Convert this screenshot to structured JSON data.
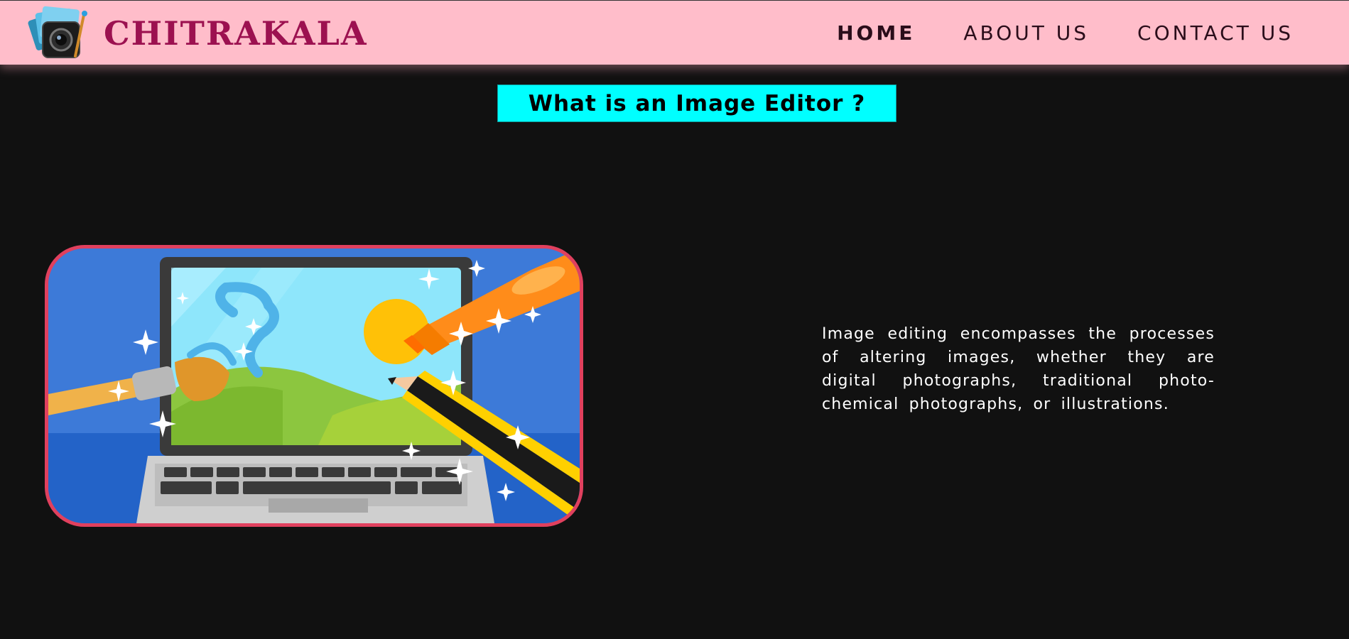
{
  "header": {
    "brand": "CHITRAKALA",
    "logo_icon": "camera-photos-icon",
    "nav": [
      {
        "label": "HOME",
        "active": true
      },
      {
        "label": "ABOUT US",
        "active": false
      },
      {
        "label": "CONTACT US",
        "active": false
      }
    ]
  },
  "main": {
    "heading": "What is an Image Editor ?",
    "illustration_icon": "laptop-image-editing-icon",
    "description": "Image editing encompasses the processes of altering images, whether they are digital photographs, traditional photo-chemical photographs, or illustrations."
  },
  "colors": {
    "navbar_bg": "#ffbdca",
    "brand": "#9c1150",
    "heading_bg": "#00ffff",
    "page_bg": "#111111",
    "illustration_border": "#e0405e"
  }
}
